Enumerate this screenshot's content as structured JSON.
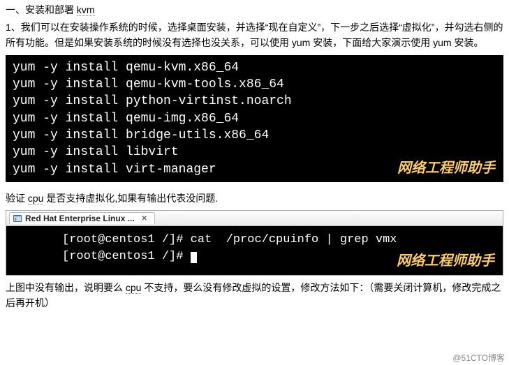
{
  "heading": {
    "prefix": "一、",
    "text": "安装和部署 ",
    "kvm": "kvm"
  },
  "paragraph1": {
    "num": "1、",
    "text": "我们可以在安装操作系统的时候，选择桌面安装，并选择“现在自定义”，下一步之后选择“虚拟化”，并勾选右侧的所有功能。但是如果安装系统的时候没有选择也没关系，可以使用 yum 安装，下面给大家演示使用 yum 安装。"
  },
  "terminal1_lines": [
    "yum -y install qemu-kvm.x86_64",
    "yum -y install qemu-kvm-tools.x86_64",
    "yum -y install python-virtinst.noarch",
    "yum -y install qemu-img.x86_64",
    "yum -y install bridge-utils.x86_64",
    "yum -y install libvirt",
    "yum -y install virt-manager"
  ],
  "watermark": "网络工程师助手",
  "subtext": {
    "before": "验证 ",
    "cpu": "cpu",
    "after": " 是否支持虚拟化,如果有输出代表没问题."
  },
  "tab": {
    "label": "Red Hat Enterprise Linux ..."
  },
  "terminal2": {
    "line1": "[root@centos1 /]# cat  /proc/cpuinfo | grep vmx",
    "line2": "[root@centos1 /]# "
  },
  "footer": {
    "before": "上图中没有输出，说明要么 ",
    "cpu": "cpu",
    "after": " 不支持，要么没有修改虚拟的设置，修改方法如下：（需要关闭计算机，修改完成之后再开机）"
  },
  "blog_mark": "@51CTO博客"
}
